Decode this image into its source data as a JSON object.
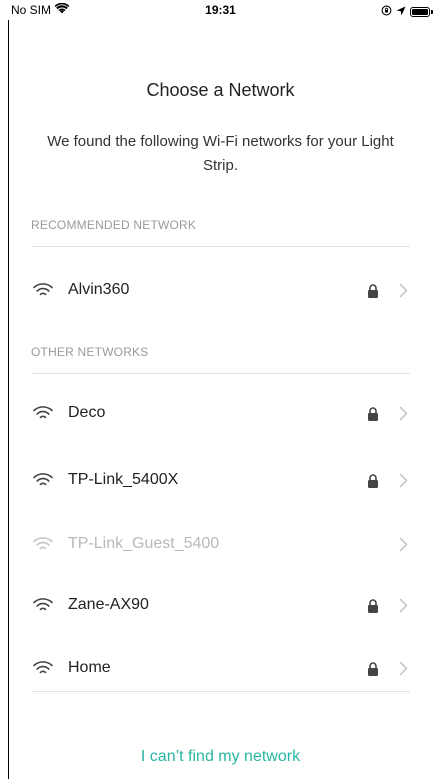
{
  "status_bar": {
    "carrier": "No SIM",
    "time": "19:31"
  },
  "header": {
    "title": "Choose a Network",
    "subtitle": "We found the following Wi-Fi networks for your Light Strip."
  },
  "recommended": {
    "label": "RECOMMENDED NETWORK",
    "network": {
      "name": "Alvin360",
      "secured": true,
      "available": true
    }
  },
  "other": {
    "label": "OTHER NETWORKS",
    "networks": [
      {
        "name": "Deco",
        "secured": true,
        "available": true
      },
      {
        "name": "TP-Link_5400X",
        "secured": true,
        "available": true
      },
      {
        "name": "TP-Link_Guest_5400",
        "secured": false,
        "available": false
      },
      {
        "name": "Zane-AX90",
        "secured": true,
        "available": true
      },
      {
        "name": "Home",
        "secured": true,
        "available": true
      }
    ]
  },
  "footer": {
    "cant_find_label": "I can’t find my network"
  },
  "colors": {
    "accent": "#27b6a2",
    "disabled_text": "#b9b9b9",
    "section_label": "#9a9a9a",
    "divider": "#e3e3e3"
  }
}
